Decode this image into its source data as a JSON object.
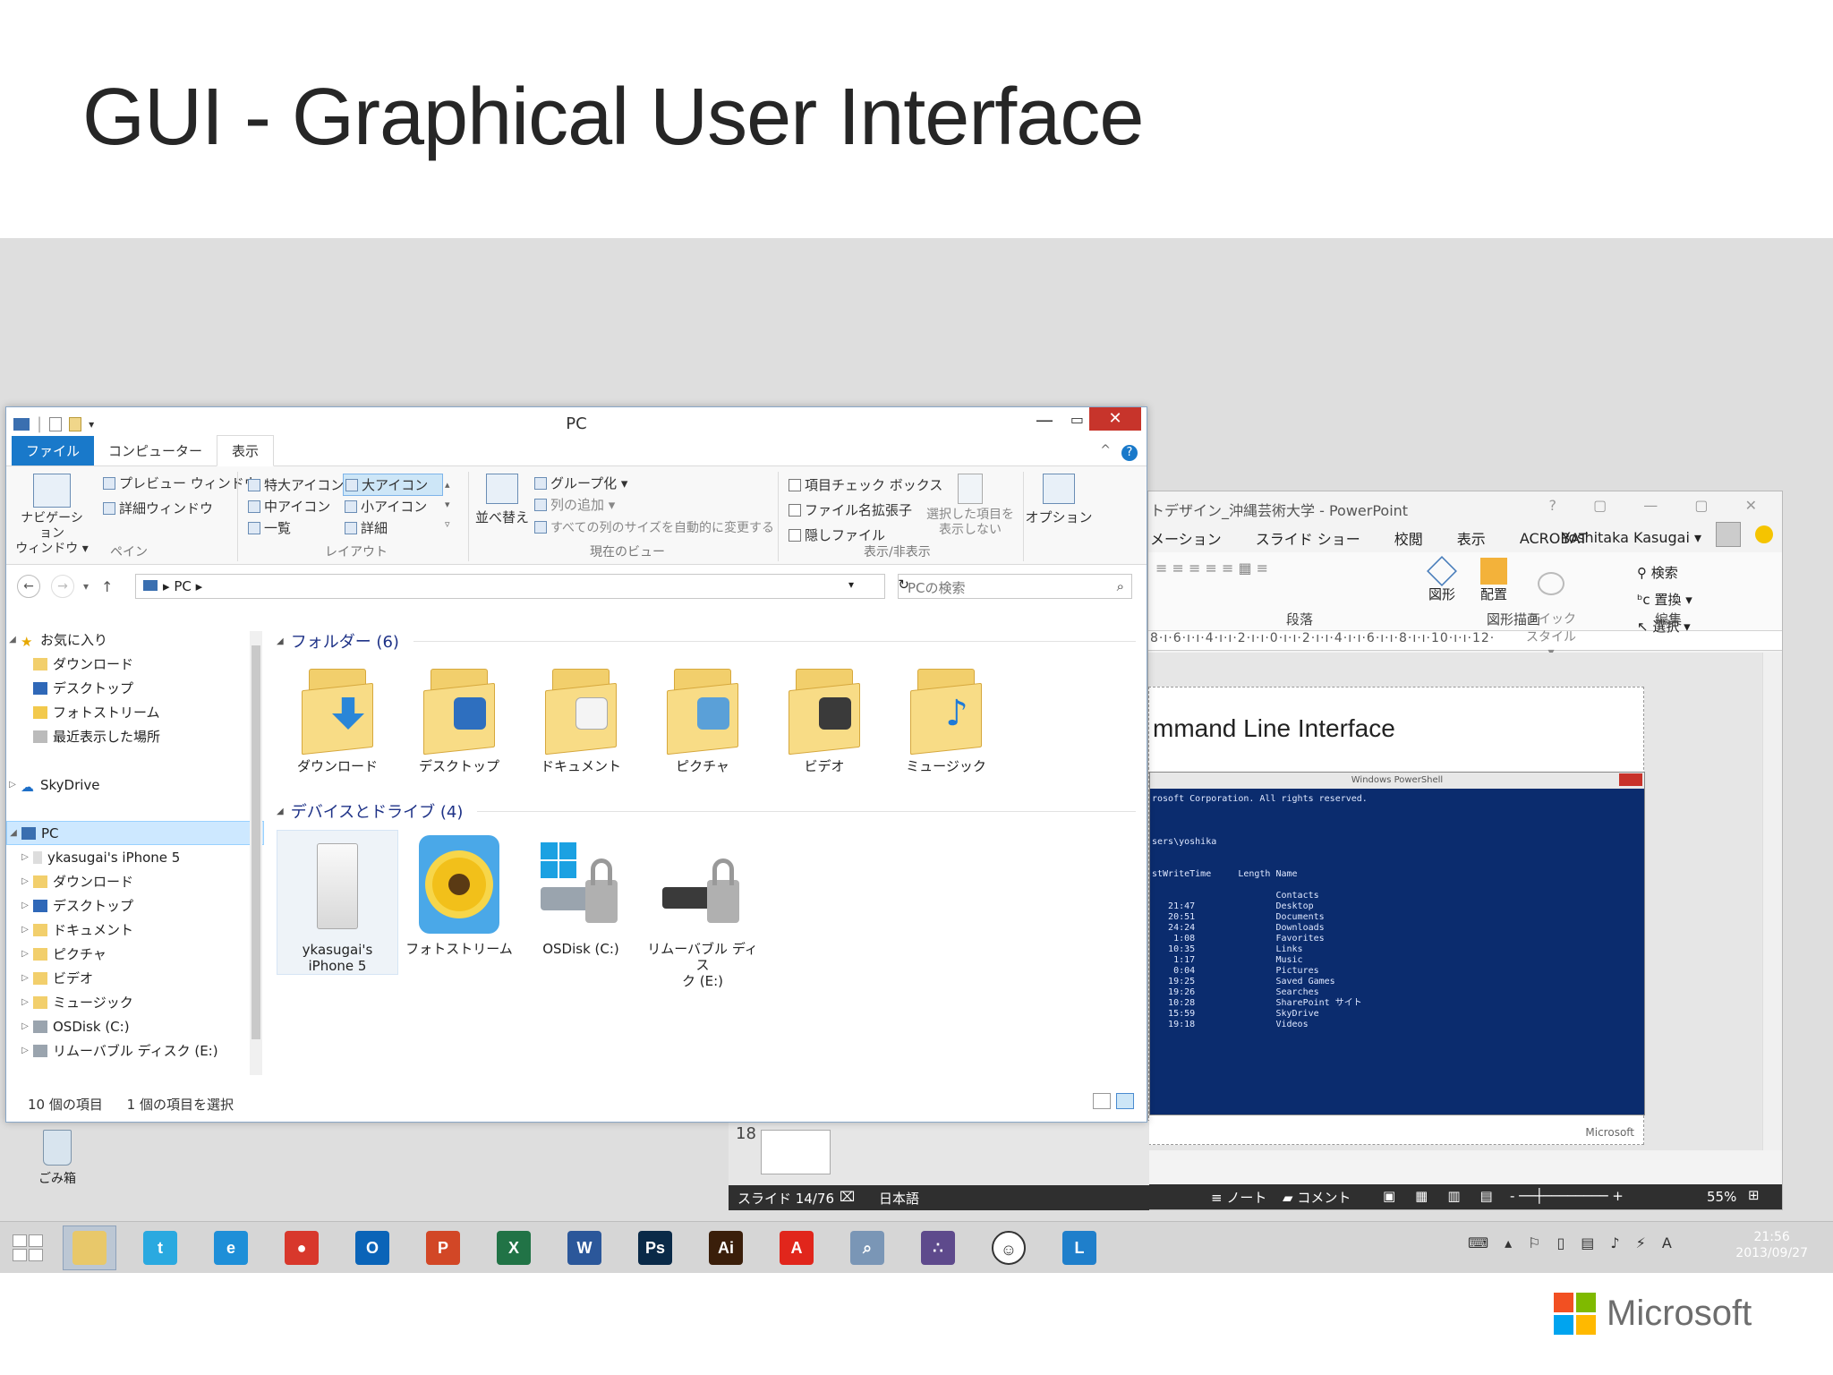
{
  "slide": {
    "title": "GUI - Graphical User Interface"
  },
  "brand": {
    "logo_text": "Microsoft",
    "colors": [
      "#f25022",
      "#7fba00",
      "#00a4ef",
      "#ffb900"
    ]
  },
  "explorer": {
    "window_title": "PC",
    "tabs": [
      "ファイル",
      "コンピューター",
      "表示"
    ],
    "ribbon": {
      "pane": {
        "nav_label": "ナビゲーション\nウィンドウ ▾",
        "preview": "プレビュー ウィンドウ",
        "details": "詳細ウィンドウ",
        "group": "ペイン"
      },
      "layout": {
        "xl": "特大アイコン",
        "large": "大アイコン",
        "medium": "中アイコン",
        "small": "小アイコン",
        "list": "一覧",
        "details": "詳細",
        "group": "レイアウト"
      },
      "view": {
        "sort": "並べ替え",
        "groupby": "グループ化 ▾",
        "addcol": "列の追加 ▾",
        "autosize": "すべての列のサイズを自動的に変更する",
        "group": "現在のビュー"
      },
      "showhide": {
        "checkbox": "項目チェック ボックス",
        "ext": "ファイル名拡張子",
        "hidden": "隠しファイル",
        "hidesel": "選択した項目を\n表示しない",
        "group": "表示/非表示"
      },
      "options": "オプション"
    },
    "address": {
      "path": "PC",
      "search_placeholder": "PCの検索"
    },
    "nav": {
      "favorites": "お気に入り",
      "fav_items": [
        "ダウンロード",
        "デスクトップ",
        "フォトストリーム",
        "最近表示した場所"
      ],
      "skydrive": "SkyDrive",
      "pc": "PC",
      "pc_items": [
        "ykasugai's iPhone 5",
        "ダウンロード",
        "デスクトップ",
        "ドキュメント",
        "ピクチャ",
        "ビデオ",
        "ミュージック",
        "OSDisk (C:)",
        "リムーバブル ディスク (E:)"
      ]
    },
    "folders_header": "フォルダー (6)",
    "folders": [
      "ダウンロード",
      "デスクトップ",
      "ドキュメント",
      "ピクチャ",
      "ビデオ",
      "ミュージック"
    ],
    "drives_header": "デバイスとドライブ (4)",
    "drives": [
      "ykasugai's\niPhone 5",
      "フォトストリーム",
      "OSDisk (C:)",
      "リムーバブル ディス\nク (E:)"
    ],
    "status": {
      "items": "10 個の項目",
      "selected": "1 個の項目を選択"
    }
  },
  "powerpoint": {
    "title": "トデザイン_沖縄芸術大学 - PowerPoint",
    "tabs": [
      "メーション",
      "スライド ショー",
      "校閲",
      "表示",
      "ACROBAT"
    ],
    "user": "Yoshitaka Kasugai ▾",
    "ribbon": {
      "shapes": "図形",
      "arrange": "配置",
      "quick": "クイック\nスタイル ▾",
      "find": "検索",
      "replace": "置換 ▾",
      "select": "選択 ▾",
      "g_para": "段落",
      "g_draw": "図形描画",
      "g_edit": "編集"
    },
    "ruler": "8·ı·6·ı·ı·4·ı·ı·2·ı·ı·0·ı·ı·2·ı·ı·4·ı·ı·6·ı·ı·8·ı·ı·10·ı·ı·12·",
    "slide_heading": "mmand Line Interface",
    "ps_title": "Windows PowerShell",
    "ps_text": "rosoft Corporation. All rights reserved.\n\n\n\nsers\\yoshika\n\n\nstWriteTime     Length Name\n\n                       Contacts\n   21:47               Desktop\n   20:51               Documents\n   24:24               Downloads\n    1:08               Favorites\n   10:35               Links\n    1:17               Music\n    0:04               Pictures\n   19:25               Saved Games\n   19:26               Searches\n   10:28               SharePoint サイト\n   15:59               SkyDrive\n   19:18               Videos",
    "slide_num": "18",
    "ms_mark": "Microsoft",
    "status": {
      "slide": "スライド 14/76",
      "lang": "日本語",
      "notes": "ノート",
      "comments": "コメント",
      "zoom": "55%"
    }
  },
  "desktop": {
    "recycle": "ごみ箱"
  },
  "taskbar": {
    "apps": [
      {
        "name": "explorer",
        "glyph": "",
        "color": "#e8c86a"
      },
      {
        "name": "twitter",
        "glyph": "t",
        "color": "#2aa9e0"
      },
      {
        "name": "ie",
        "glyph": "e",
        "color": "#1e8fd8"
      },
      {
        "name": "chrome",
        "glyph": "●",
        "color": "#d8382c"
      },
      {
        "name": "outlook",
        "glyph": "O",
        "color": "#0a64b8"
      },
      {
        "name": "powerpoint",
        "glyph": "P",
        "color": "#d24726"
      },
      {
        "name": "excel",
        "glyph": "X",
        "color": "#217346"
      },
      {
        "name": "word",
        "glyph": "W",
        "color": "#2b579a"
      },
      {
        "name": "photoshop",
        "glyph": "Ps",
        "color": "#0a2a48"
      },
      {
        "name": "illustrator",
        "glyph": "Ai",
        "color": "#3a1e0a"
      },
      {
        "name": "acrobat",
        "glyph": "A",
        "color": "#e1261c"
      },
      {
        "name": "search",
        "glyph": "⌕",
        "color": "#7a96b6"
      },
      {
        "name": "team",
        "glyph": "∴",
        "color": "#5e4a8c"
      },
      {
        "name": "face",
        "glyph": "☺",
        "color": "#ffffff"
      },
      {
        "name": "lync",
        "glyph": "L",
        "color": "#1f7fcb"
      }
    ],
    "time": "21:56",
    "date": "2013/09/27"
  }
}
